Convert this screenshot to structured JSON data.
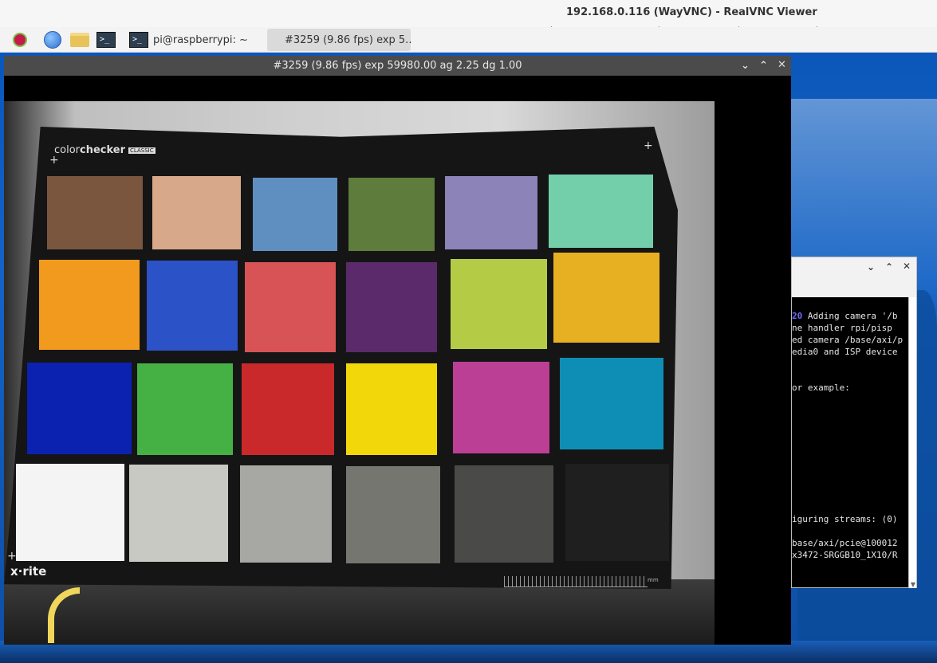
{
  "viewer": {
    "title": "192.168.0.116 (WayVNC) - RealVNC Viewer"
  },
  "panel": {
    "launchers": [
      {
        "name": "raspberry-pi-menu-icon"
      },
      {
        "name": "web-browser-icon"
      },
      {
        "name": "file-manager-icon"
      },
      {
        "name": "terminal-icon"
      }
    ],
    "terminal_glyph": ">_",
    "tasks": {
      "terminal_label": "pi@raspberrypi: ~",
      "camera_label": "#3259 (9.86 fps) exp 5.."
    }
  },
  "camera_window": {
    "title": "#3259 (9.86 fps) exp 59980.00 ag 2.25 dg 1.00",
    "controls": {
      "minimize": "⌄",
      "maximize": "⌃",
      "close": "✕"
    },
    "checker": {
      "brand_light": "color",
      "brand_bold": "checker",
      "badge": "CLASSIC",
      "maker": "x·rite",
      "ruler_unit": "mm",
      "patch_colors": [
        "#7a563f",
        "#d8a88a",
        "#5f8ec1",
        "#5e7c3c",
        "#8c83b8",
        "#73cfaa",
        "#f29a1e",
        "#2c52c8",
        "#d85356",
        "#5b2a6a",
        "#b4cc45",
        "#e7b023",
        "#0b22b0",
        "#45b145",
        "#c9292b",
        "#f2d80a",
        "#bc3f96",
        "#0f8eb5",
        "#f4f4f4",
        "#c9c9c4",
        "#a7a7a3",
        "#767671",
        "#4a4a48",
        "#1f1f1f"
      ]
    }
  },
  "terminal_window": {
    "controls": {
      "minimize": "⌄",
      "maximize": "⌃",
      "close": "✕"
    },
    "lines": [
      {
        "prefix": "20",
        "text": " Adding camera '/b"
      },
      {
        "prefix": "",
        "text": "ne handler rpi/pisp"
      },
      {
        "prefix": "",
        "text": "ed camera /base/axi/p"
      },
      {
        "prefix": "",
        "text": "edia0 and ISP device"
      },
      {
        "prefix": "",
        "text": ""
      },
      {
        "prefix": "",
        "text": ""
      },
      {
        "prefix": "",
        "text": "or example:"
      },
      {
        "prefix": "",
        "text": ""
      },
      {
        "prefix": "",
        "text": ""
      },
      {
        "prefix": "",
        "text": ""
      },
      {
        "prefix": "",
        "text": ""
      },
      {
        "prefix": "",
        "text": ""
      },
      {
        "prefix": "",
        "text": ""
      },
      {
        "prefix": "",
        "text": ""
      },
      {
        "prefix": "",
        "text": ""
      },
      {
        "prefix": "",
        "text": ""
      },
      {
        "prefix": "",
        "text": ""
      },
      {
        "prefix": "",
        "text": "iguring streams: (0)"
      },
      {
        "prefix": "",
        "text": ""
      },
      {
        "prefix": "",
        "text": "base/axi/pcie@100012"
      },
      {
        "prefix": "",
        "text": "x3472-SRGGB10_1X10/R"
      }
    ]
  }
}
